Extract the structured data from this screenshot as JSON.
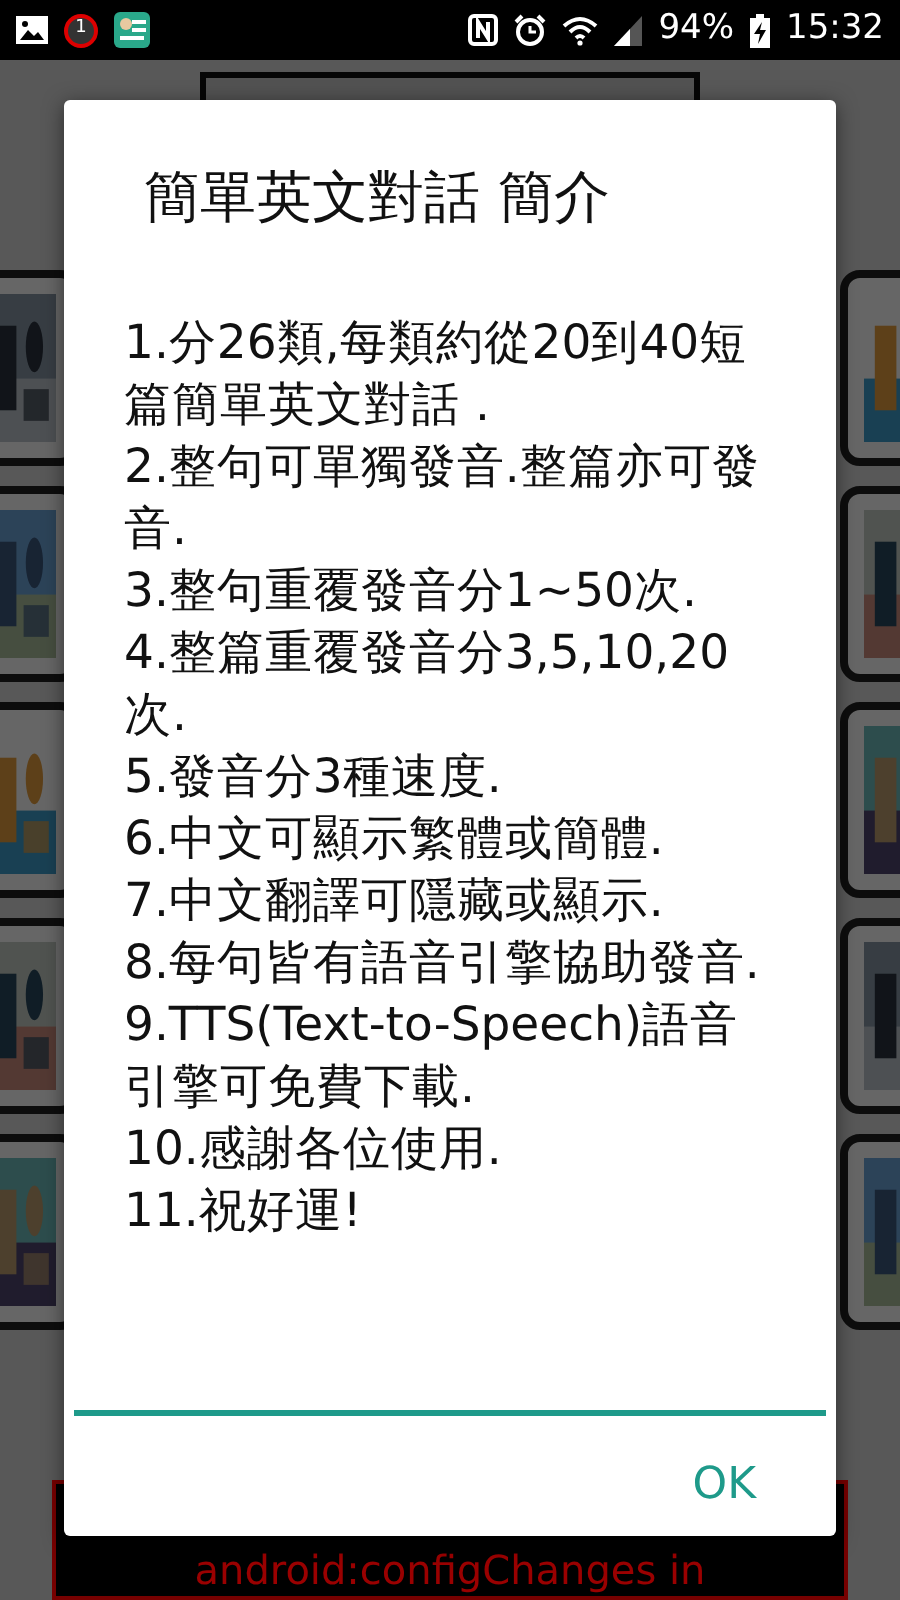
{
  "status_bar": {
    "notification_count": "1",
    "battery": "94%",
    "time": "15:32"
  },
  "background": {
    "footer_text": "android:configChanges in"
  },
  "dialog": {
    "title": "簡單英文對話 簡介",
    "items": [
      "1.分26類,每類約從20到40短篇簡單英文對話 .",
      "2.整句可單獨發音.整篇亦可發音.",
      "3.整句重覆發音分1~50次.",
      "4.整篇重覆發音分3,5,10,20次.",
      "5.發音分3種速度.",
      "6.中文可顯示繁體或簡體.",
      "7.中文翻譯可隱藏或顯示.",
      "8.每句皆有語音引擎協助發音.",
      "9.TTS(Text-to-Speech)語音引擎可免費下載.",
      "10.感謝各位使用.",
      "11.祝好運!"
    ],
    "buttons": [
      "OK"
    ]
  }
}
